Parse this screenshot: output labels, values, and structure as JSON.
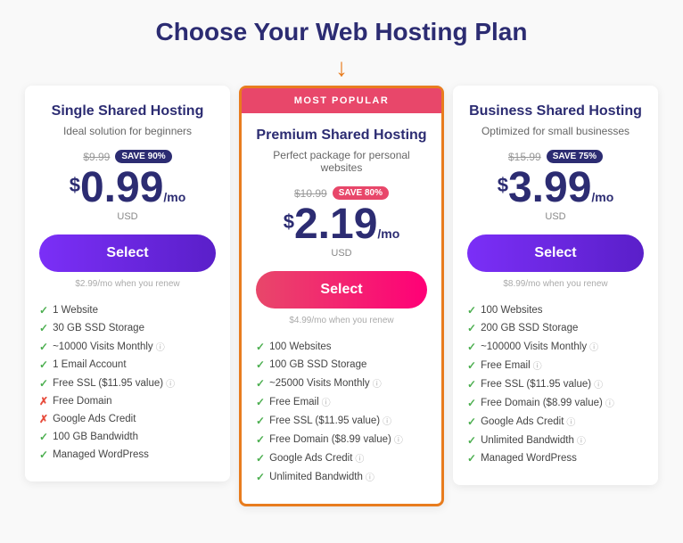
{
  "page": {
    "title": "Choose Your Web Hosting Plan"
  },
  "plans": [
    {
      "id": "single",
      "name": "Single Shared Hosting",
      "desc": "Ideal solution for beginners",
      "original_price": "$9.99",
      "save_badge": "SAVE 90%",
      "price_dollar": "$",
      "price_number": "0.99",
      "price_mo": "/mo",
      "price_usd": "USD",
      "renew_note": "$2.99/mo when you renew",
      "select_label": "Select",
      "btn_style": "purple",
      "popular": false,
      "features": [
        {
          "check": true,
          "text": "1 Website"
        },
        {
          "check": true,
          "text": "30 GB SSD Storage"
        },
        {
          "check": true,
          "text": "~10000 Visits Monthly",
          "info": true
        },
        {
          "check": true,
          "text": "1 Email Account"
        },
        {
          "check": true,
          "text": "Free SSL ($11.95 value)",
          "info": true
        },
        {
          "check": false,
          "text": "Free Domain"
        },
        {
          "check": false,
          "text": "Google Ads Credit"
        },
        {
          "check": true,
          "text": "100 GB Bandwidth"
        },
        {
          "check": true,
          "text": "Managed WordPress"
        }
      ]
    },
    {
      "id": "premium",
      "name": "Premium Shared Hosting",
      "desc": "Perfect package for personal websites",
      "original_price": "$10.99",
      "save_badge": "SAVE 80%",
      "price_dollar": "$",
      "price_number": "2.19",
      "price_mo": "/mo",
      "price_usd": "USD",
      "renew_note": "$4.99/mo when you renew",
      "select_label": "Select",
      "btn_style": "pink",
      "popular": true,
      "popular_label": "MOST POPULAR",
      "features": [
        {
          "check": true,
          "text": "100 Websites"
        },
        {
          "check": true,
          "text": "100 GB SSD Storage"
        },
        {
          "check": true,
          "text": "~25000 Visits Monthly",
          "info": true
        },
        {
          "check": true,
          "text": "Free Email",
          "info": true
        },
        {
          "check": true,
          "text": "Free SSL ($11.95 value)",
          "info": true
        },
        {
          "check": true,
          "text": "Free Domain ($8.99 value)",
          "info": true
        },
        {
          "check": true,
          "text": "Google Ads Credit",
          "info": true
        },
        {
          "check": true,
          "text": "Unlimited Bandwidth",
          "info": true
        }
      ]
    },
    {
      "id": "business",
      "name": "Business Shared Hosting",
      "desc": "Optimized for small businesses",
      "original_price": "$15.99",
      "save_badge": "SAVE 75%",
      "price_dollar": "$",
      "price_number": "3.99",
      "price_mo": "/mo",
      "price_usd": "USD",
      "renew_note": "$8.99/mo when you renew",
      "select_label": "Select",
      "btn_style": "purple",
      "popular": false,
      "features": [
        {
          "check": true,
          "text": "100 Websites"
        },
        {
          "check": true,
          "text": "200 GB SSD Storage"
        },
        {
          "check": true,
          "text": "~100000 Visits Monthly",
          "info": true
        },
        {
          "check": true,
          "text": "Free Email",
          "info": true
        },
        {
          "check": true,
          "text": "Free SSL ($11.95 value)",
          "info": true
        },
        {
          "check": true,
          "text": "Free Domain ($8.99 value)",
          "info": true
        },
        {
          "check": true,
          "text": "Google Ads Credit",
          "info": true
        },
        {
          "check": true,
          "text": "Unlimited Bandwidth",
          "info": true
        },
        {
          "check": true,
          "text": "Managed WordPress"
        }
      ]
    }
  ]
}
